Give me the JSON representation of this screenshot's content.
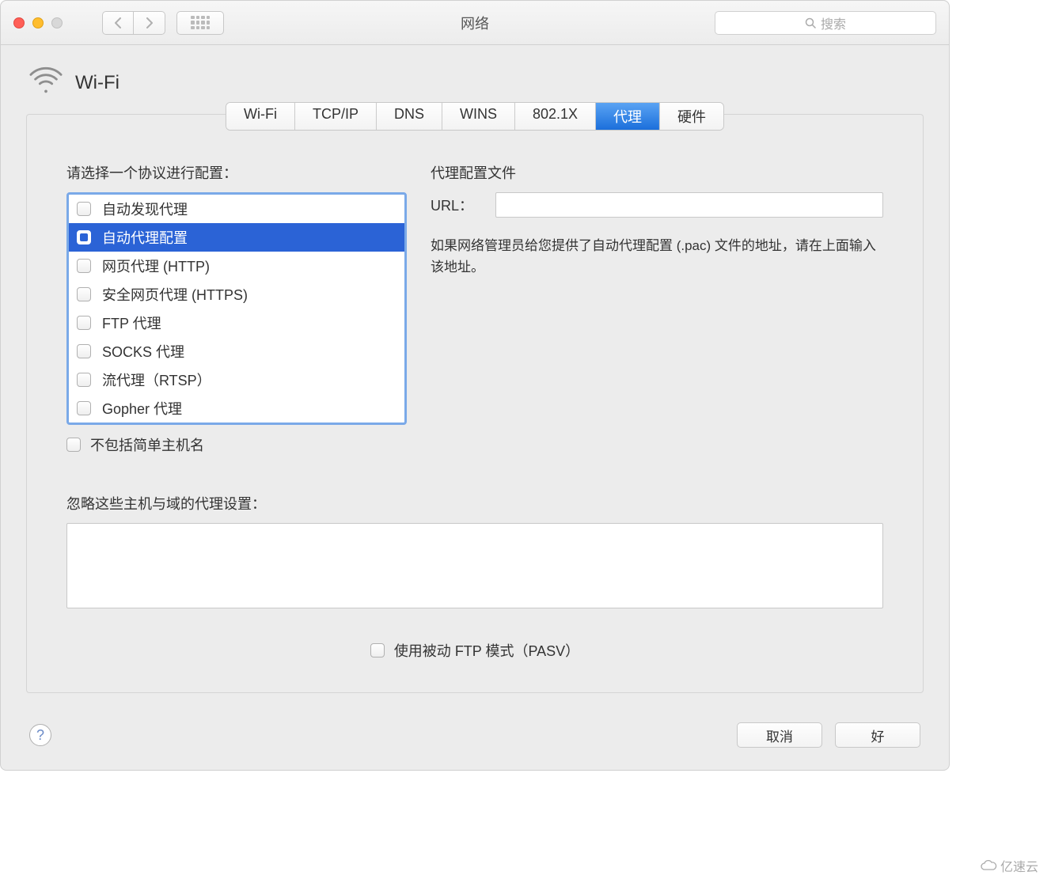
{
  "window": {
    "title": "网络",
    "search_placeholder": "搜索"
  },
  "header": {
    "interface": "Wi-Fi"
  },
  "tabs": [
    {
      "label": "Wi-Fi",
      "active": false
    },
    {
      "label": "TCP/IP",
      "active": false
    },
    {
      "label": "DNS",
      "active": false
    },
    {
      "label": "WINS",
      "active": false
    },
    {
      "label": "802.1X",
      "active": false
    },
    {
      "label": "代理",
      "active": true
    },
    {
      "label": "硬件",
      "active": false
    }
  ],
  "left": {
    "protocol_label": "请选择一个协议进行配置：",
    "protocols": [
      {
        "label": "自动发现代理",
        "checked": false,
        "selected": false
      },
      {
        "label": "自动代理配置",
        "checked": true,
        "selected": true
      },
      {
        "label": "网页代理 (HTTP)",
        "checked": false,
        "selected": false
      },
      {
        "label": "安全网页代理 (HTTPS)",
        "checked": false,
        "selected": false
      },
      {
        "label": "FTP 代理",
        "checked": false,
        "selected": false
      },
      {
        "label": "SOCKS 代理",
        "checked": false,
        "selected": false
      },
      {
        "label": "流代理（RTSP）",
        "checked": false,
        "selected": false
      },
      {
        "label": "Gopher 代理",
        "checked": false,
        "selected": false
      }
    ],
    "exclude_simple": "不包括简单主机名"
  },
  "right": {
    "pac_heading": "代理配置文件",
    "url_label": "URL：",
    "url_value": "",
    "pac_description": "如果网络管理员给您提供了自动代理配置 (.pac) 文件的地址，请在上面输入该地址。"
  },
  "bypass": {
    "label": "忽略这些主机与域的代理设置：",
    "value": ""
  },
  "pasv": {
    "label": "使用被动 FTP 模式（PASV）"
  },
  "buttons": {
    "help": "?",
    "cancel": "取消",
    "ok": "好"
  },
  "watermark": "亿速云"
}
